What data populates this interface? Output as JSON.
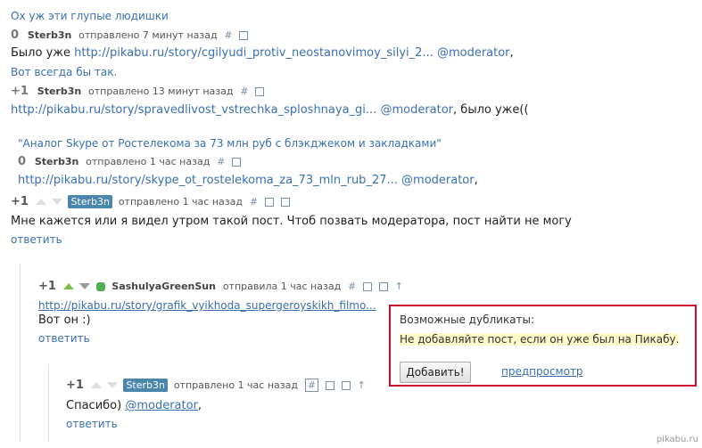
{
  "thread": {
    "c1_quote": "Ох уж эти глупые людишки",
    "c1_rating": "0",
    "c1_user": "Sterb3n",
    "c1_meta": "отправлено 7 минут назад",
    "c1_hash": "#",
    "c1_text": "Было уже",
    "c1_link": "http://pikabu.ru/story/cgilyudi_protiv_neostanovimoy_silyi_2...",
    "c1_mention": "@moderator",
    "c1_tail": ",",
    "c2_quote": "Вот всегда бы так.",
    "c2_rating": "+1",
    "c2_user": "Sterb3n",
    "c2_meta": "отправлено 13 минут назад",
    "c2_hash": "#",
    "c2_link": "http://pikabu.ru/story/spravedlivost_vstrechka_sploshnaya_gi...",
    "c2_mention": "@moderator",
    "c2_tail": ", было уже((",
    "c3_quote": "\"Аналог Skype от Ростелекома за 73 млн руб с блэкджеком и закладками\"",
    "c3_rating": "0",
    "c3_user": "Sterb3n",
    "c3_meta": "отправлено 1 час назад",
    "c3_hash": "#",
    "c3_link": "http://pikabu.ru/story/skype_ot_rostelekoma_za_73_mln_rub_27...",
    "c3_mention": "@moderator",
    "c3_tail": ",",
    "c4_rating": "+1",
    "c4_user": "Sterb3n",
    "c4_meta": "отправлено 1 час назад",
    "c4_hash": "#",
    "c4_text": "Мне кажется или я видел утром такой пост. Чтоб позвать модератора, пост найти не могу",
    "c4_reply": "ответить",
    "c5_rating": "+1",
    "c5_user": "SashulyaGreenSun",
    "c5_meta": "отправила 1 час назад",
    "c5_hash": "#",
    "c5_link": "http://pikabu.ru/story/grafik_vyikhoda_supergeroyskikh_filmo...",
    "c5_text": "Вот он :)",
    "c5_reply": "ответить",
    "c6_rating": "+1",
    "c6_user": "Sterb3n",
    "c6_meta": "отправлено 1 час назад",
    "c6_hash": "#",
    "c6_text": "Спасибо)",
    "c6_mention": "@moderator",
    "c6_tail": ",",
    "c6_reply": "ответить"
  },
  "dup_panel": {
    "title": "Возможные дубликаты:",
    "warning": "Не добавляйте пост, если он уже был на Пикабу.",
    "add_button": "Добавить!",
    "preview_link": "предпросмотр"
  },
  "watermark": "pikabu.ru",
  "colors": {
    "link": "#3a6fb0",
    "badge": "#4b86ad",
    "highlight": "#c8102e",
    "up_green": "#7cc043"
  },
  "icons": [
    "hash-icon",
    "save-icon",
    "collapse-icon",
    "up-arrow-icon"
  ]
}
